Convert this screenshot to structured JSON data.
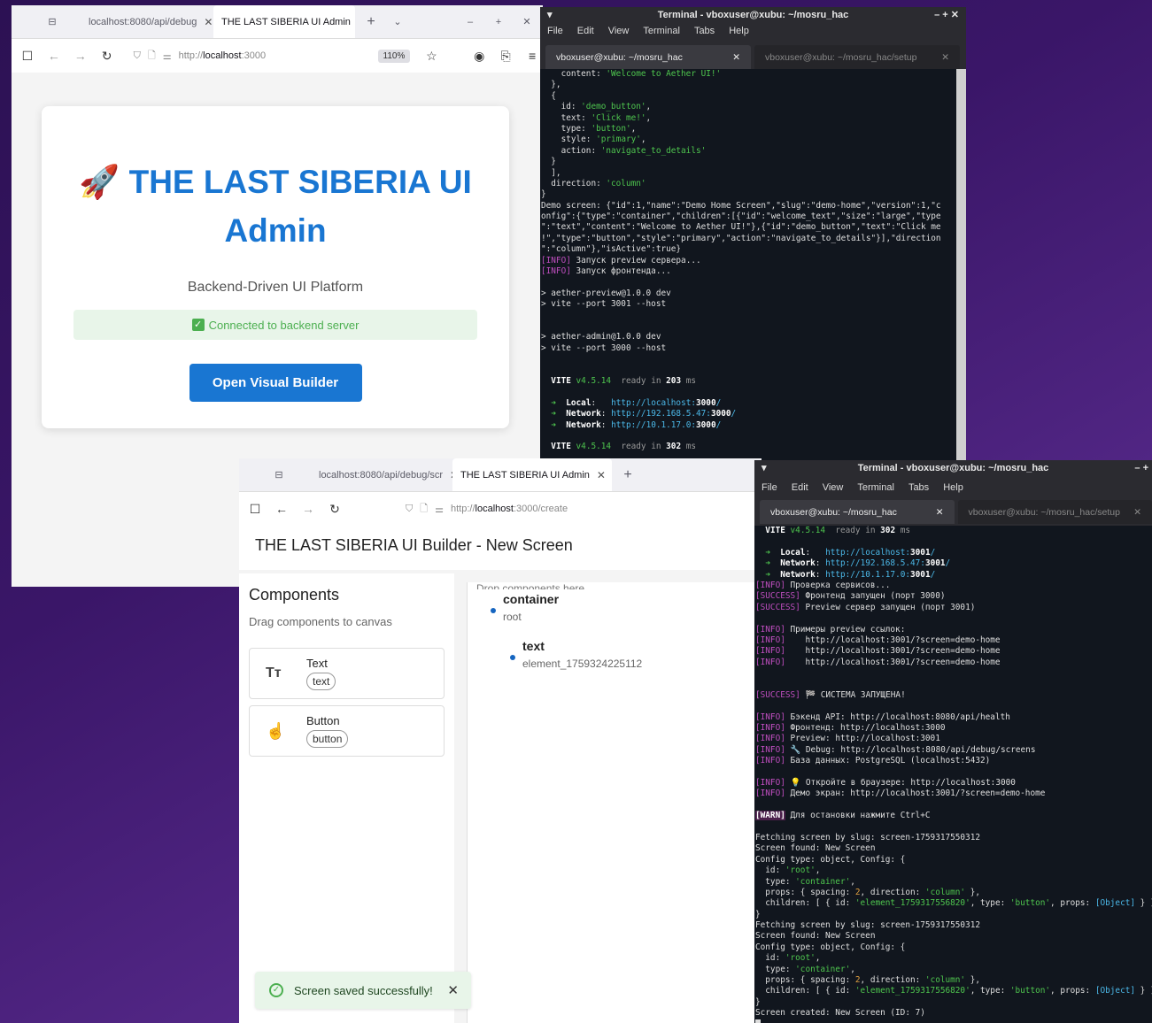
{
  "win1": {
    "tabs": [
      {
        "label": "localhost:8080/api/debug"
      },
      {
        "label": "THE LAST SIBERIA UI Admin"
      }
    ],
    "url_prefix": "http://",
    "url_host": "localhost",
    "url_rest": ":3000",
    "zoom": "110%",
    "card": {
      "emoji": "🚀",
      "title": "THE LAST SIBERIA UI Admin",
      "subtitle": "Backend-Driven UI Platform",
      "status": "Connected to backend server",
      "button": "Open Visual Builder"
    }
  },
  "term1": {
    "title": "Terminal - vboxuser@xubu: ~/mosru_hac",
    "menu": [
      "File",
      "Edit",
      "View",
      "Terminal",
      "Tabs",
      "Help"
    ],
    "tabs": [
      "vboxuser@xubu: ~/mosru_hac",
      "vboxuser@xubu: ~/mosru_hac/setup"
    ],
    "lines": [
      "    content: 'Welcome to Aether UI!'",
      "  },",
      "  {",
      "    id: 'demo_button',",
      "    text: 'Click me!',",
      "    type: 'button',",
      "    style: 'primary',",
      "    action: 'navigate_to_details'",
      "  }",
      "  ],",
      "  direction: 'column'",
      "}",
      "Demo screen: {\"id\":1,\"name\":\"Demo Home Screen\",\"slug\":\"demo-home\",\"version\":1,\"c",
      "onfig\":{\"type\":\"container\",\"children\":[{\"id\":\"welcome_text\",\"size\":\"large\",\"type",
      "\":\"text\",\"content\":\"Welcome to Aether UI!\"},{\"id\":\"demo_button\",\"text\":\"Click me",
      "!\",\"type\":\"button\",\"style\":\"primary\",\"action\":\"navigate_to_details\"}],\"direction",
      "\":\"column\"},\"isActive\":true}",
      "[INFO] Запуск preview сервера...",
      "[INFO] Запуск фронтенда...",
      "",
      "> aether-preview@1.0.0 dev",
      "> vite --port 3001 --host",
      "",
      "",
      "> aether-admin@1.0.0 dev",
      "> vite --port 3000 --host",
      "",
      "",
      "  VITE v4.5.14  ready in 203 ms",
      "",
      "  ➜  Local:   http://localhost:3000/",
      "  ➜  Network: http://192.168.5.47:3000/",
      "  ➜  Network: http://10.1.17.0:3000/",
      "",
      "  VITE v4.5.14  ready in 302 ms"
    ]
  },
  "win2": {
    "tabs": [
      {
        "label": "localhost:8080/api/debug/scr"
      },
      {
        "label": "THE LAST SIBERIA UI Admin"
      }
    ],
    "url_prefix": "http://",
    "url_host": "localhost",
    "url_rest": ":3000/create",
    "header": "THE LAST SIBERIA UI Builder - New Screen",
    "components_title": "Components",
    "components_hint": "Drag components to canvas",
    "components": [
      {
        "name": "Text",
        "tag": "text",
        "icon": "Tт"
      },
      {
        "name": "Button",
        "tag": "button",
        "icon": "☝"
      }
    ],
    "canvas_hint": "Drop components here",
    "tree": [
      {
        "type": "container",
        "id": "root"
      },
      {
        "type": "text",
        "id": "element_1759324225112"
      }
    ],
    "toast": "Screen saved successfully!"
  },
  "term2": {
    "title": "Terminal - vboxuser@xubu: ~/mosru_hac",
    "menu": [
      "File",
      "Edit",
      "View",
      "Terminal",
      "Tabs",
      "Help"
    ],
    "tabs": [
      "vboxuser@xubu: ~/mosru_hac",
      "vboxuser@xubu: ~/mosru_hac/setup"
    ],
    "lines": [
      "  VITE v4.5.14  ready in 302 ms",
      "",
      "  ➜  Local:   http://localhost:3001/",
      "  ➜  Network: http://192.168.5.47:3001/",
      "  ➜  Network: http://10.1.17.0:3001/",
      "[INFO] Проверка сервисов...",
      "[SUCCESS] Фронтенд запущен (порт 3000)",
      "[SUCCESS] Preview сервер запущен (порт 3001)",
      "",
      "[INFO] Примеры preview ссылок:",
      "[INFO]    http://localhost:3001/?screen=demo-home",
      "[INFO]    http://localhost:3001/?screen=demo-home",
      "[INFO]    http://localhost:3001/?screen=demo-home",
      "",
      "",
      "[SUCCESS] 🏁 СИСТЕМА ЗАПУЩЕНА!",
      "",
      "[INFO] Бэкенд API: http://localhost:8080/api/health",
      "[INFO] Фронтенд: http://localhost:3000",
      "[INFO] Preview: http://localhost:3001",
      "[INFO] 🔧 Debug: http://localhost:8080/api/debug/screens",
      "[INFO] База данных: PostgreSQL (localhost:5432)",
      "",
      "[INFO] 💡 Откройте в браузере: http://localhost:3000",
      "[INFO] Демо экран: http://localhost:3001/?screen=demo-home",
      "",
      "[WARN] Для остановки нажмите Ctrl+C",
      "",
      "Fetching screen by slug: screen-1759317550312",
      "Screen found: New Screen",
      "Config type: object, Config: {",
      "  id: 'root',",
      "  type: 'container',",
      "  props: { spacing: 2, direction: 'column' },",
      "  children: [ { id: 'element_1759317556820', type: 'button', props: [Object] } ]",
      "}",
      "Fetching screen by slug: screen-1759317550312",
      "Screen found: New Screen",
      "Config type: object, Config: {",
      "  id: 'root',",
      "  type: 'container',",
      "  props: { spacing: 2, direction: 'column' },",
      "  children: [ { id: 'element_1759317556820', type: 'button', props: [Object] } ]",
      "}",
      "Screen created: New Screen (ID: 7)"
    ]
  }
}
